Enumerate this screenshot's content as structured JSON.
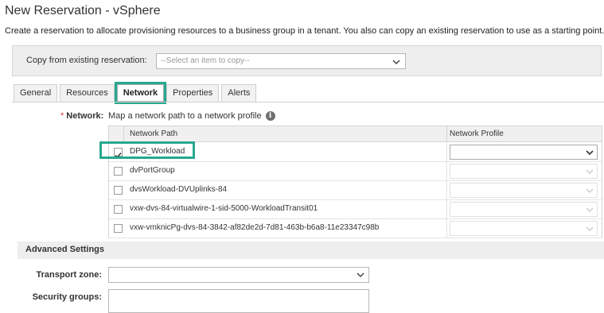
{
  "page": {
    "title": "New Reservation - vSphere",
    "description": "Create a reservation to allocate provisioning resources to a business group in a tenant. You also can copy an existing reservation to use as a starting point."
  },
  "copy": {
    "label": "Copy from existing reservation:",
    "placeholder": "--Select an item to copy--"
  },
  "tabs": [
    {
      "label": "General",
      "active": false
    },
    {
      "label": "Resources",
      "active": false
    },
    {
      "label": "Network",
      "active": true
    },
    {
      "label": "Properties",
      "active": false
    },
    {
      "label": "Alerts",
      "active": false
    }
  ],
  "network": {
    "required_mark": "*",
    "label": "Network:",
    "hint": "Map a network path to a network profile",
    "info_icon": "info-icon",
    "columns": {
      "path": "Network Path",
      "profile": "Network Profile"
    },
    "rows": [
      {
        "path": "DPG_Workload",
        "checked": true,
        "profile": ""
      },
      {
        "path": "dvPortGroup",
        "checked": false,
        "profile": ""
      },
      {
        "path": "dvsWorkload-DVUplinks-84",
        "checked": false,
        "profile": ""
      },
      {
        "path": "vxw-dvs-84-virtualwire-1-sid-5000-WorkloadTransit01",
        "checked": false,
        "profile": ""
      },
      {
        "path": "vxw-vmknicPg-dvs-84-3842-af82de2d-7d81-463b-b6a8-11e23347c98b",
        "checked": false,
        "profile": ""
      }
    ]
  },
  "advanced": {
    "title": "Advanced Settings",
    "transport_zone_label": "Transport zone:",
    "security_groups_label": "Security groups:"
  },
  "colors": {
    "highlight": "#27a88f",
    "required": "#d9352d"
  }
}
